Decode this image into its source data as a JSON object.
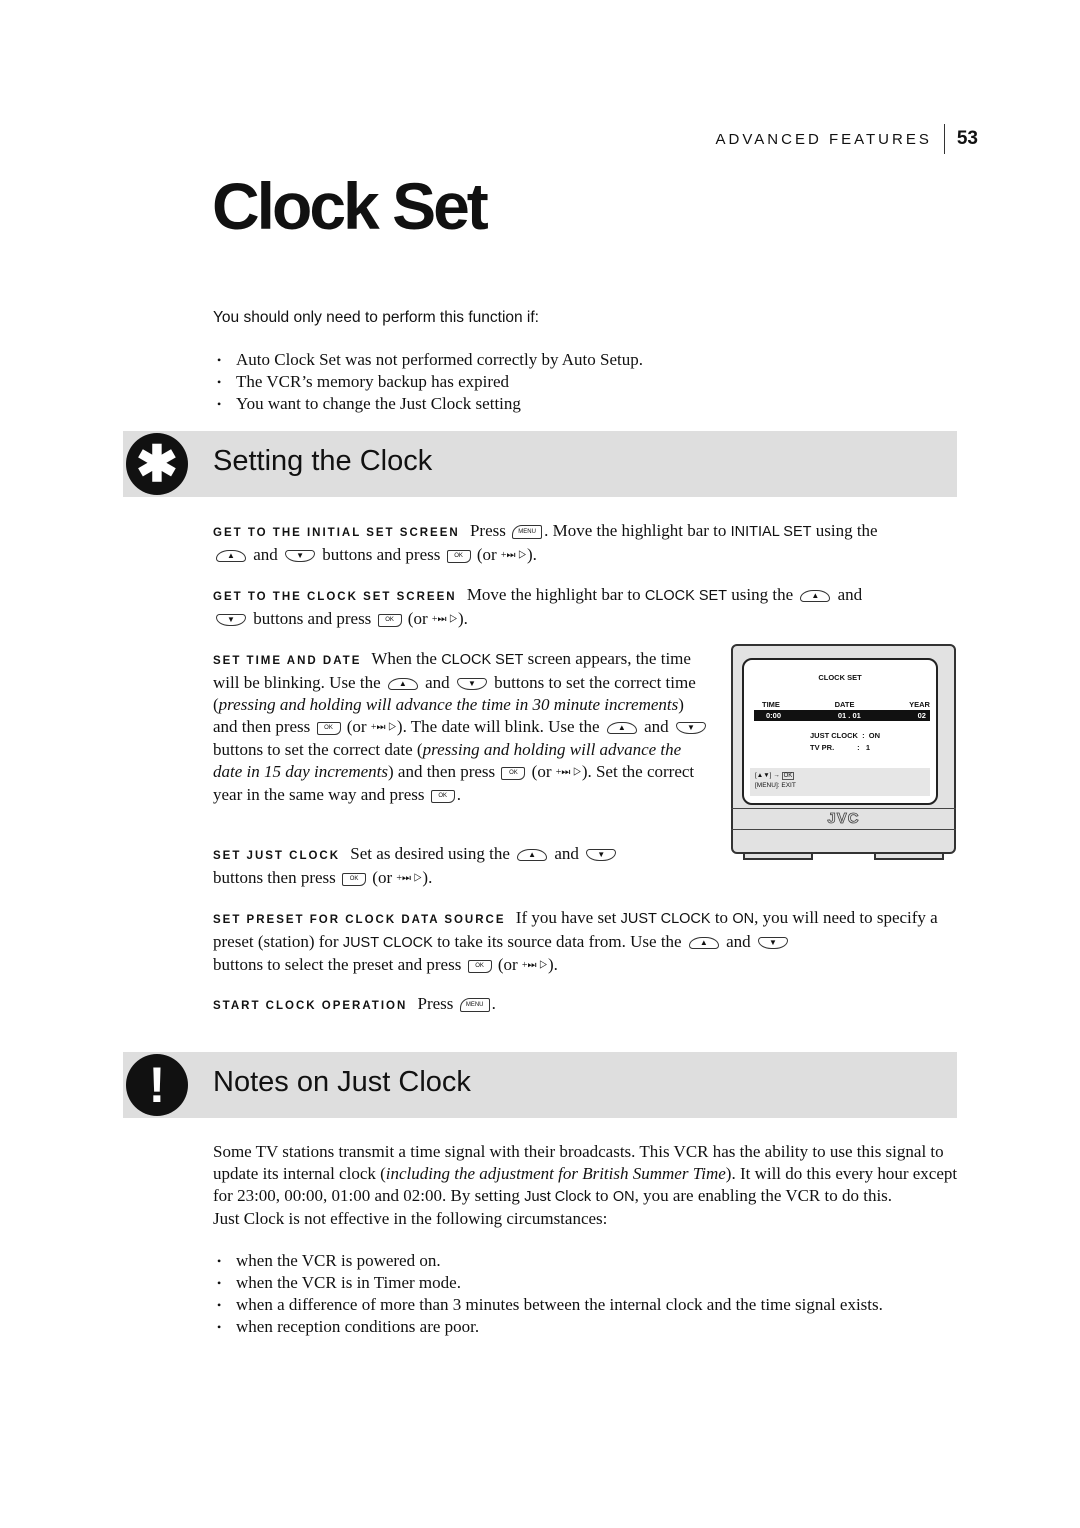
{
  "header": {
    "section": "ADVANCED FEATURES",
    "page_number": "53"
  },
  "title": "Clock Set",
  "intro": {
    "heading": "You should only need to perform this function if:",
    "bullets": [
      "Auto Clock Set was not performed correctly by Auto Setup.",
      "The VCR’s memory backup has expired",
      "You want to change the Just Clock setting"
    ]
  },
  "icons": {
    "up": "▲",
    "down": "▼",
    "ok": "OK",
    "menu": "MENU",
    "alt": "+⏭ ▷"
  },
  "setting_clock": {
    "icon": "✱",
    "title": "Setting the Clock",
    "steps": {
      "initial": {
        "lead": "GET TO THE INITIAL SET SCREEN",
        "t1": "Press",
        "t2": ". Move the highlight bar to",
        "kw": "INITIAL SET",
        "t3": "using the",
        "t4": "and",
        "t5": "buttons and press",
        "t6": "(or",
        "t7": ")."
      },
      "clockset": {
        "lead": "GET TO THE CLOCK SET SCREEN",
        "t1": "Move the highlight bar to",
        "kw": "CLOCK SET",
        "t2": "using the",
        "t3": "and",
        "t4": "buttons and press",
        "t5": "(or",
        "t6": ")."
      },
      "timedate": {
        "lead": "SET TIME AND DATE",
        "t1": "When the",
        "kw": "CLOCK SET",
        "t2": "screen appears, the time will be blinking. Use the",
        "t3": "and",
        "t4": "buttons to set the correct time (",
        "i1": "pressing and holding will advance the time in 30 minute increments",
        "t5": ") and then press",
        "t6": "(or",
        "t7": "). The date will blink. Use the",
        "t8": "and",
        "t9": "buttons to set the correct date (",
        "i2": "pressing and holding will advance the date in 15 day increments",
        "t10": ") and then press",
        "t11": "(or",
        "t12": "). Set the correct year in the same way and press",
        "t13": "."
      },
      "justclock": {
        "lead": "SET JUST CLOCK",
        "t1": "Set as desired using the",
        "t2": "and",
        "t3": "buttons then press",
        "t4": "(or",
        "t5": ")."
      },
      "preset": {
        "lead": "SET PRESET FOR CLOCK DATA SOURCE",
        "t1": "If you have set",
        "kw1": "JUST CLOCK",
        "t2": "to",
        "kw2": "ON",
        "t3": ", you will need to specify a preset (station) for",
        "kw3": "JUST CLOCK",
        "t4": "to take its source data from. Use the",
        "t5": "and",
        "t6": "buttons to select the preset and press",
        "t7": "(or",
        "t8": ")."
      },
      "start": {
        "lead": "START CLOCK OPERATION",
        "t1": "Press",
        "t2": "."
      }
    },
    "screen": {
      "title": "CLOCK SET",
      "col_time": "TIME",
      "col_date": "DATE",
      "col_year": "YEAR",
      "time": "0:00",
      "date": "01 . 01",
      "year": "02",
      "just_clock": "JUST CLOCK  :  ON",
      "tv_pr": "TV PR.           :   1",
      "help1": "[▲▼] →",
      "help_ok": "OK",
      "help2": "[MENU]: EXIT",
      "brand": "JVC"
    }
  },
  "notes": {
    "icon": "!",
    "title": "Notes on Just Clock",
    "p1a": "Some TV stations transmit a time signal with their broadcasts. This VCR has the ability to use this signal to update its internal clock (",
    "p1i": "including the adjustment for British Summer Time",
    "p1b": "). It will do this every hour except for 23:00, 00:00, 01:00 and 02:00. By setting",
    "p1kw1": "Just Clock",
    "p1c": "to",
    "p1kw2": "ON",
    "p1d": ", you are enabling the VCR to do this.",
    "p2": "Just Clock is not effective in the following circumstances:",
    "bullets": [
      "when the VCR is powered on.",
      "when the VCR is in Timer mode.",
      "when a difference of more than 3 minutes between the internal clock and the time signal exists.",
      "when reception conditions are poor."
    ]
  }
}
